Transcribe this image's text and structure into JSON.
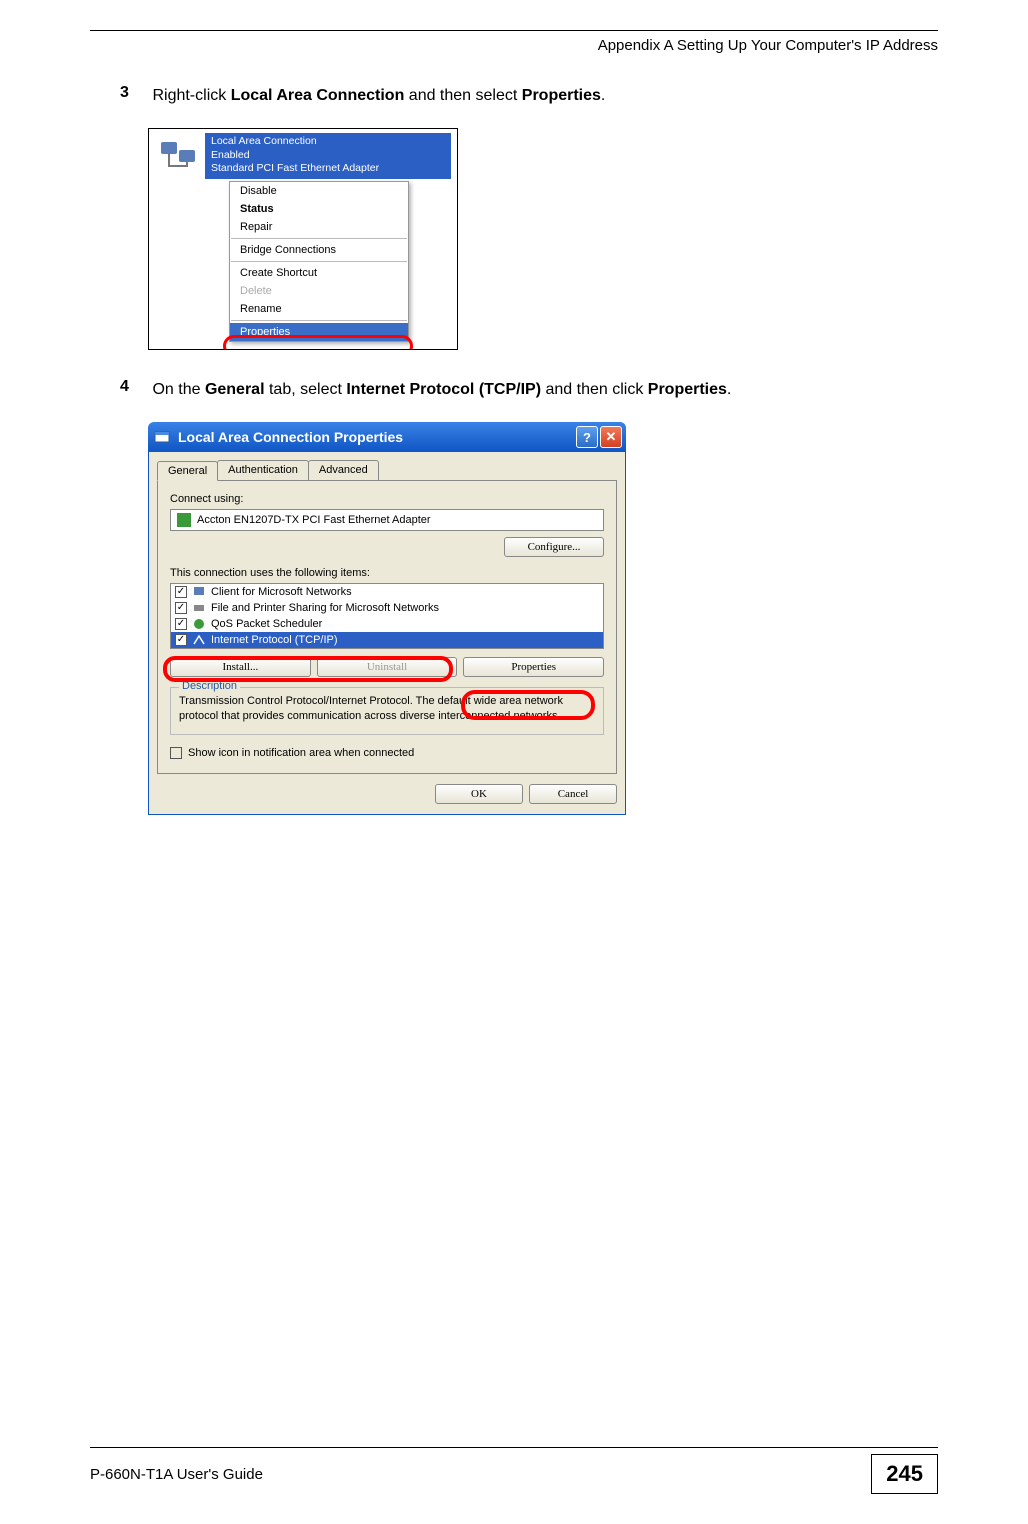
{
  "header": {
    "appendix": "Appendix A Setting Up Your Computer's IP Address"
  },
  "step3": {
    "num": "3",
    "t1": "Right-click ",
    "b1": "Local Area Connection",
    "t2": " and then select ",
    "b2": "Properties",
    "t3": "."
  },
  "fig1": {
    "conn_name": "Local Area Connection",
    "conn_status": "Enabled",
    "conn_adapter": "Standard PCI Fast Ethernet Adapter",
    "menu": {
      "disable": "Disable",
      "status": "Status",
      "repair": "Repair",
      "bridge": "Bridge Connections",
      "shortcut": "Create Shortcut",
      "delete": "Delete",
      "rename": "Rename",
      "properties": "Properties"
    }
  },
  "step4": {
    "num": "4",
    "t1": "On the ",
    "b1": "General",
    "t2": " tab, select ",
    "b2": "Internet Protocol (TCP/IP)",
    "t3": " and then click ",
    "b3": "Properties",
    "t4": "."
  },
  "fig2": {
    "title": "Local Area Connection Properties",
    "tabs": {
      "general": "General",
      "auth": "Authentication",
      "adv": "Advanced"
    },
    "connect_using": "Connect using:",
    "adapter": "Accton EN1207D-TX PCI Fast Ethernet Adapter",
    "configure": "Configure...",
    "items_label": "This connection uses the following items:",
    "items": {
      "i1": "Client for Microsoft Networks",
      "i2": "File and Printer Sharing for Microsoft Networks",
      "i3": "QoS Packet Scheduler",
      "i4": "Internet Protocol (TCP/IP)"
    },
    "install": "Install...",
    "uninstall": "Uninstall",
    "properties": "Properties",
    "desc_group": "Description",
    "desc_text": "Transmission Control Protocol/Internet Protocol. The default wide area network protocol that provides communication across diverse interconnected networks.",
    "show_icon": "Show icon in notification area when connected",
    "ok": "OK",
    "cancel": "Cancel"
  },
  "footer": {
    "guide": "P-660N-T1A User's Guide",
    "page": "245"
  }
}
